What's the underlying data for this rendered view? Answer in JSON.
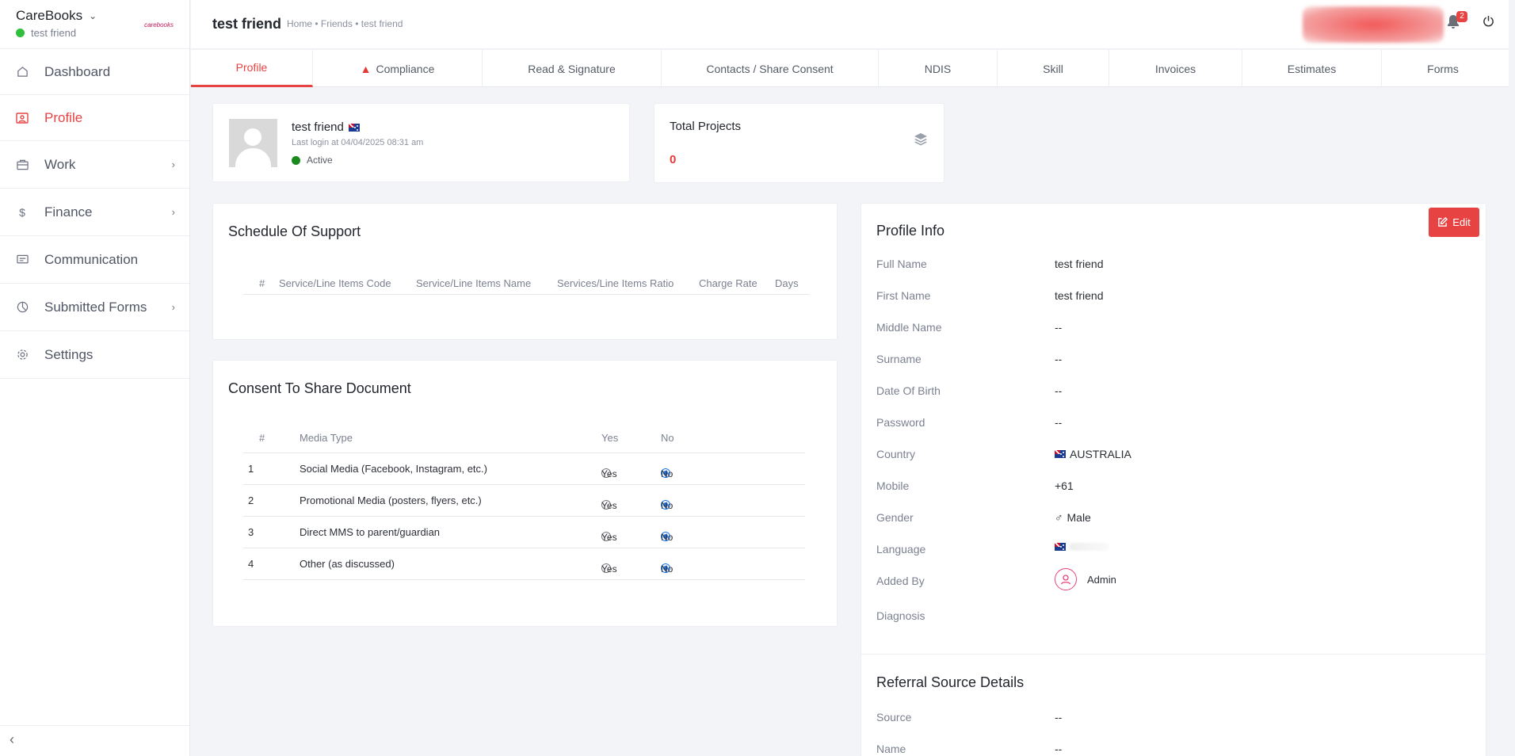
{
  "sidebar": {
    "app_name": "CareBooks",
    "user_name": "test friend",
    "logo_text": "carebooks",
    "items": [
      {
        "label": "Dashboard",
        "icon": "home-icon"
      },
      {
        "label": "Profile",
        "icon": "profile-icon"
      },
      {
        "label": "Work",
        "icon": "briefcase-icon"
      },
      {
        "label": "Finance",
        "icon": "dollar-icon"
      },
      {
        "label": "Communication",
        "icon": "message-icon"
      },
      {
        "label": "Submitted Forms",
        "icon": "pie-chart-icon"
      },
      {
        "label": "Settings",
        "icon": "gear-icon"
      }
    ]
  },
  "header": {
    "title": "test friend",
    "breadcrumb": "Home • Friends • test friend",
    "notification_count": "2"
  },
  "tabs": [
    "Profile",
    "Compliance",
    "Read & Signature",
    "Contacts / Share Consent",
    "NDIS",
    "Skill",
    "Invoices",
    "Estimates",
    "Forms"
  ],
  "user_card": {
    "name": "test friend",
    "last_login": "Last login at 04/04/2025 08:31 am",
    "status": "Active"
  },
  "projects": {
    "title": "Total Projects",
    "value": "0"
  },
  "schedule": {
    "title": "Schedule Of Support",
    "columns": [
      "#",
      "Service/Line Items Code",
      "Service/Line Items Name",
      "Services/Line Items Ratio",
      "Charge Rate",
      "Days"
    ]
  },
  "consent": {
    "title": "Consent To Share Document",
    "columns": [
      "#",
      "Media Type",
      "Yes",
      "No"
    ],
    "rows": [
      {
        "num": "1",
        "type": "Social Media (Facebook, Instagram, etc.)",
        "yes": "Yes",
        "no": "No"
      },
      {
        "num": "2",
        "type": "Promotional Media (posters, flyers, etc.)",
        "yes": "Yes",
        "no": "No"
      },
      {
        "num": "3",
        "type": "Direct MMS to parent/guardian",
        "yes": "Yes",
        "no": "No"
      },
      {
        "num": "4",
        "type": "Other (as discussed)",
        "yes": "Yes",
        "no": "No"
      }
    ]
  },
  "profile_info": {
    "title": "Profile Info",
    "edit_label": "Edit",
    "fields": [
      {
        "label": "Full Name",
        "value": "test friend"
      },
      {
        "label": "First Name",
        "value": "test friend"
      },
      {
        "label": "Middle Name",
        "value": "--"
      },
      {
        "label": "Surname",
        "value": "--"
      },
      {
        "label": "Date Of Birth",
        "value": "--"
      },
      {
        "label": "Password",
        "value": "--"
      },
      {
        "label": "Country",
        "value": "AUSTRALIA"
      },
      {
        "label": "Mobile",
        "value": "+61"
      },
      {
        "label": "Gender",
        "value": "Male"
      },
      {
        "label": "Language",
        "value": ""
      },
      {
        "label": "Added By",
        "value": "Admin"
      },
      {
        "label": "Diagnosis",
        "value": ""
      }
    ]
  },
  "referral": {
    "title": "Referral Source Details",
    "fields": [
      {
        "label": "Source",
        "value": "--"
      },
      {
        "label": "Name",
        "value": "--"
      }
    ]
  }
}
